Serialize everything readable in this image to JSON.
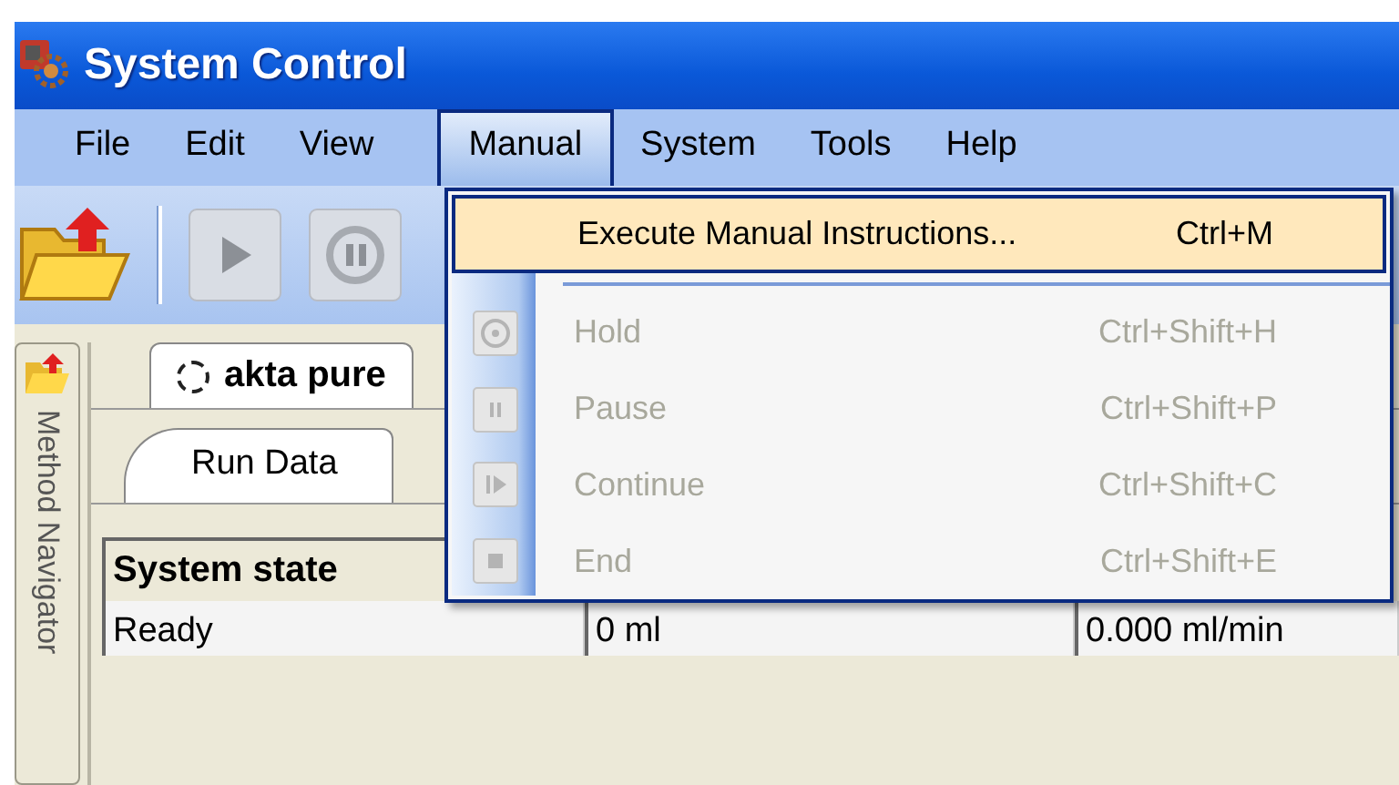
{
  "window": {
    "title": "System Control"
  },
  "menu_bar": [
    {
      "label": "File",
      "selected": false
    },
    {
      "label": "Edit",
      "selected": false
    },
    {
      "label": "View",
      "selected": false
    },
    {
      "label": "Manual",
      "selected": true
    },
    {
      "label": "System",
      "selected": false
    },
    {
      "label": "Tools",
      "selected": false
    },
    {
      "label": "Help",
      "selected": false
    }
  ],
  "side_panel": {
    "label": "Method Navigator"
  },
  "system_tabs": [
    {
      "label": "akta pure",
      "selected": true
    }
  ],
  "view_tabs": [
    {
      "label": "Run Data",
      "selected": true
    }
  ],
  "table": {
    "columns": [
      "System state"
    ],
    "rows": [
      [
        "Ready",
        "0 ml",
        "0.000 ml/min"
      ]
    ]
  },
  "menu": {
    "items": [
      {
        "kind": "command",
        "label": "Execute Manual Instructions...",
        "shortcut": "Ctrl+M",
        "highlighted": true,
        "disabled": false
      },
      {
        "kind": "separator"
      },
      {
        "kind": "command",
        "label": "Hold",
        "shortcut": "Ctrl+Shift+H",
        "highlighted": false,
        "disabled": true
      },
      {
        "kind": "command",
        "label": "Pause",
        "shortcut": "Ctrl+Shift+P",
        "highlighted": false,
        "disabled": true
      },
      {
        "kind": "command",
        "label": "Continue",
        "shortcut": "Ctrl+Shift+C",
        "highlighted": false,
        "disabled": true
      },
      {
        "kind": "command",
        "label": "End",
        "shortcut": "Ctrl+Shift+E",
        "highlighted": false,
        "disabled": true
      }
    ]
  }
}
